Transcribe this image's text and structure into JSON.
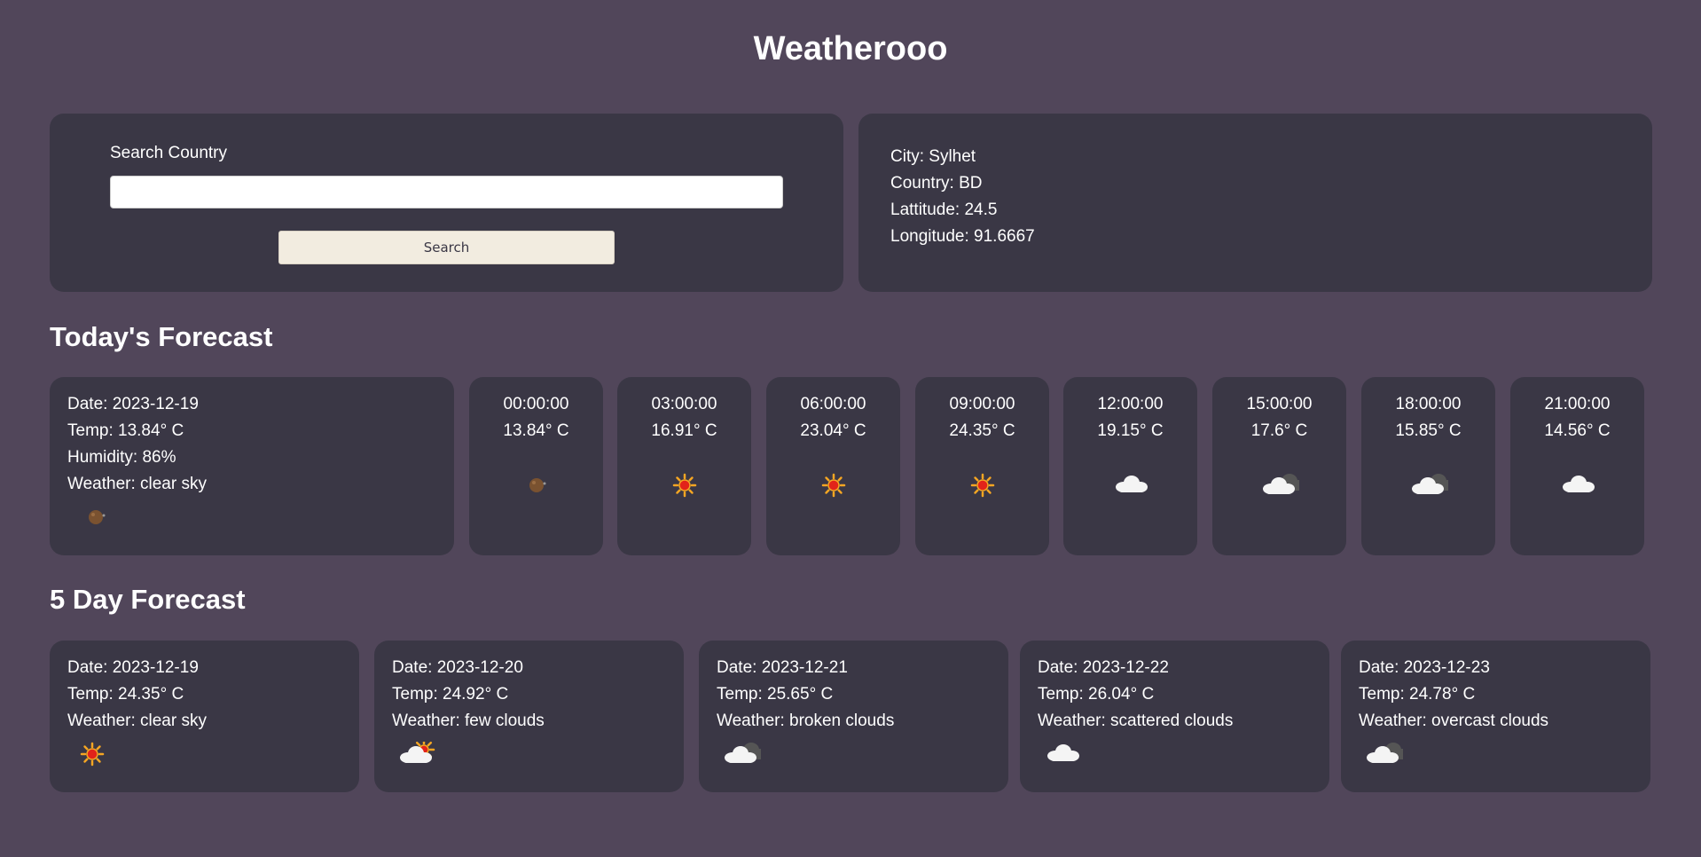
{
  "app": {
    "title": "Weatherooo"
  },
  "search": {
    "label": "Search Country",
    "value": "",
    "placeholder": "",
    "button_label": "Search"
  },
  "location": {
    "city": "City: Sylhet",
    "country": "Country: BD",
    "latitude": "Lattitude: 24.5",
    "longitude": "Longitude: 91.6667"
  },
  "today": {
    "section_title": "Today's Forecast",
    "date": "Date: 2023-12-19",
    "temp": "Temp: 13.84° C",
    "humidity": "Humidity: 86%",
    "weather": "Weather: clear sky",
    "icon": "moon-icon",
    "hours": [
      {
        "time": "00:00:00",
        "temp": "13.84° C",
        "icon": "moon-icon"
      },
      {
        "time": "03:00:00",
        "temp": "16.91° C",
        "icon": "sun-icon"
      },
      {
        "time": "06:00:00",
        "temp": "23.04° C",
        "icon": "sun-icon"
      },
      {
        "time": "09:00:00",
        "temp": "24.35° C",
        "icon": "sun-icon"
      },
      {
        "time": "12:00:00",
        "temp": "19.15° C",
        "icon": "cloud-icon"
      },
      {
        "time": "15:00:00",
        "temp": "17.6° C",
        "icon": "broken-clouds-icon"
      },
      {
        "time": "18:00:00",
        "temp": "15.85° C",
        "icon": "broken-clouds-icon"
      },
      {
        "time": "21:00:00",
        "temp": "14.56° C",
        "icon": "cloud-icon"
      }
    ]
  },
  "five_day": {
    "section_title": "5 Day Forecast",
    "days": [
      {
        "date": "Date: 2023-12-19",
        "temp": "Temp: 24.35° C",
        "weather": "Weather: clear sky",
        "icon": "sun-icon"
      },
      {
        "date": "Date: 2023-12-20",
        "temp": "Temp: 24.92° C",
        "weather": "Weather: few clouds",
        "icon": "few-clouds-icon"
      },
      {
        "date": "Date: 2023-12-21",
        "temp": "Temp: 25.65° C",
        "weather": "Weather: broken clouds",
        "icon": "broken-clouds-icon"
      },
      {
        "date": "Date: 2023-12-22",
        "temp": "Temp: 26.04° C",
        "weather": "Weather: scattered clouds",
        "icon": "cloud-icon"
      },
      {
        "date": "Date: 2023-12-23",
        "temp": "Temp: 24.78° C",
        "weather": "Weather: overcast clouds",
        "icon": "broken-clouds-icon"
      }
    ]
  },
  "colors": {
    "background": "#51465a",
    "card": "#3a3745",
    "text": "#ffffff",
    "button": "#f2ece0",
    "sun": "#e2231a",
    "sun_rays": "#f5a623",
    "moon": "#7a5230",
    "cloud": "#f4f4f4",
    "dark_cloud": "#555555"
  }
}
